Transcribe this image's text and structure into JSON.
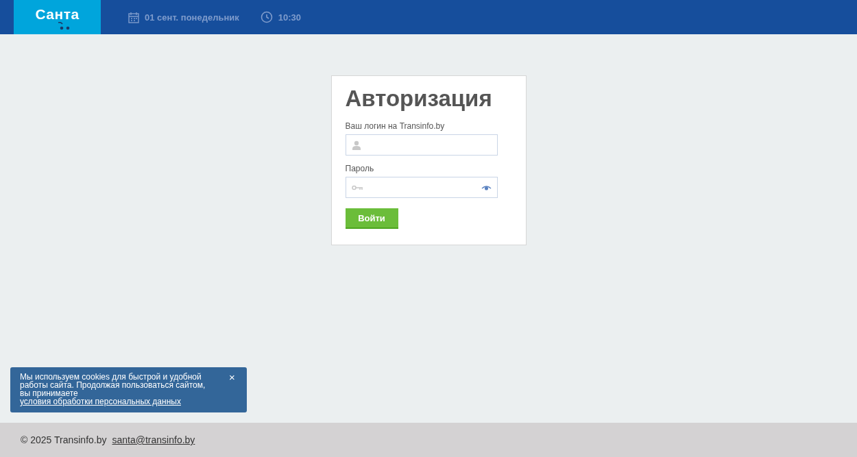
{
  "header": {
    "logo": "Санта",
    "date": "01 сент. понедельник",
    "time": "10:30"
  },
  "login_form": {
    "title": "Авторизация",
    "login_label": "Ваш логин на Transinfo.by",
    "password_label": "Пароль",
    "submit_button": "Войти"
  },
  "cookie_notice": {
    "text": "Мы используем cookies для быстрой и удобной работы сайта. Продолжая пользоваться сайтом, вы принимаете",
    "link": "условия обработки персональных данных",
    "close": "×"
  },
  "footer": {
    "copyright": "© 2025 Transinfo.by",
    "email": "santa@transinfo.by"
  }
}
